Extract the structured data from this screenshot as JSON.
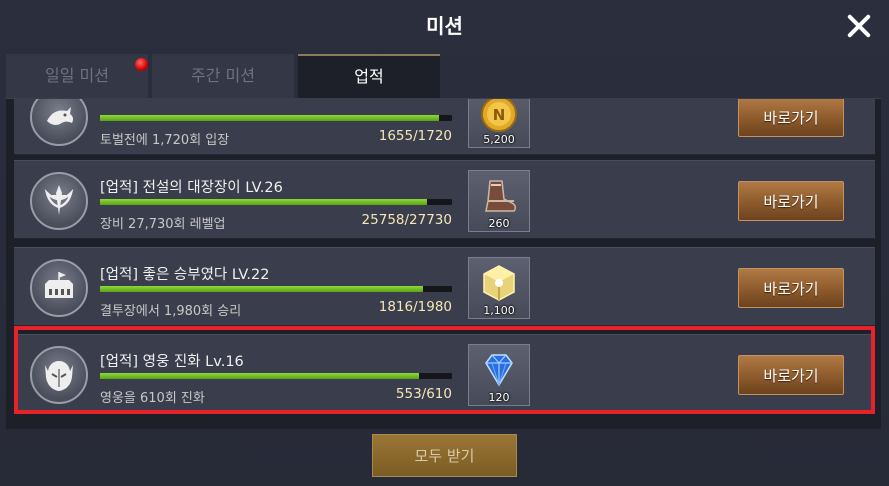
{
  "window": {
    "title": "미션"
  },
  "tabs": [
    {
      "label": "일일 미션",
      "has_alert": true
    },
    {
      "label": "주간 미션",
      "has_alert": false
    },
    {
      "label": "업적",
      "selected": true
    }
  ],
  "missions": [
    {
      "title": "",
      "desc": "토벌전에 1,720회 입장",
      "count": "1655/1720",
      "progress": 0.962,
      "badge_icon": "dragon-icon",
      "reward_icon": "gold-coin-icon",
      "reward_qty": "5,200",
      "button": "바로가기"
    },
    {
      "title": "[업적] 전설의 대장장이 LV.26",
      "desc": "장비 27,730회 레벨업",
      "count": "25758/27730",
      "progress": 0.929,
      "badge_icon": "sword-emblem-icon",
      "reward_icon": "boots-icon",
      "reward_qty": "260",
      "button": "바로가기"
    },
    {
      "title": "[업적] 좋은 승부였다 LV.22",
      "desc": "결투장에서 1,980회 승리",
      "count": "1816/1980",
      "progress": 0.917,
      "badge_icon": "arena-icon",
      "reward_icon": "cube-icon",
      "reward_qty": "1,100",
      "button": "바로가기"
    },
    {
      "title": "[업적] 영웅 진화 Lv.16",
      "desc": "영웅을 610회 진화",
      "count": "553/610",
      "progress": 0.907,
      "badge_icon": "hero-mask-icon",
      "reward_icon": "diamond-icon",
      "reward_qty": "120",
      "button": "바로가기",
      "highlighted": true
    }
  ],
  "footer": {
    "claim_all": "모두 받기"
  },
  "colors": {
    "progress": "#7cc22a",
    "highlight": "#e8222b",
    "button": "#8d5a2c",
    "alert": "#d40000"
  }
}
